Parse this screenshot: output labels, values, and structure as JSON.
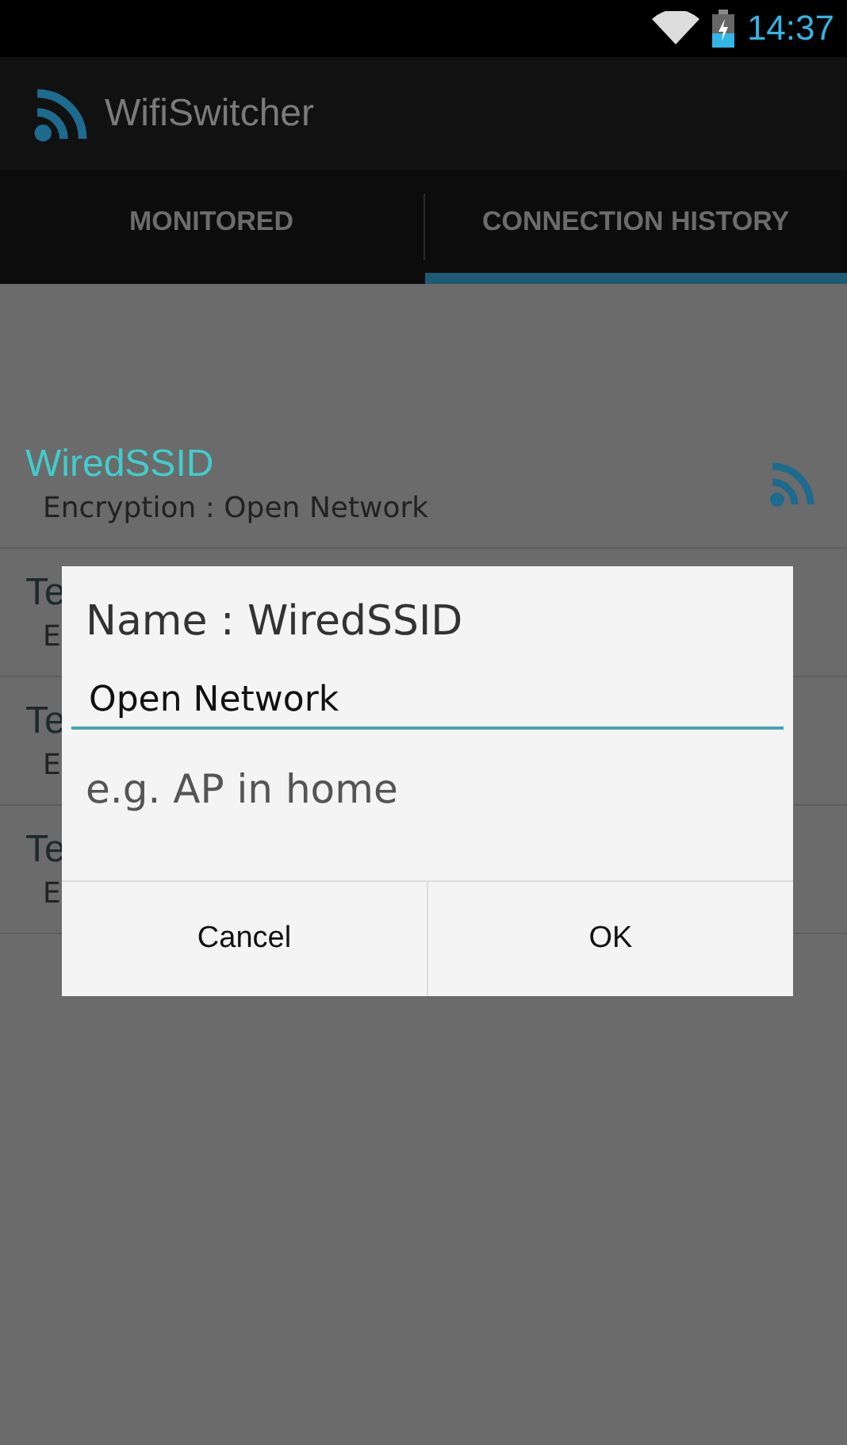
{
  "status_bar": {
    "time": "14:37"
  },
  "action_bar": {
    "title": "WifiSwitcher"
  },
  "tabs": [
    {
      "label": "MONITORED",
      "selected": false
    },
    {
      "label": "CONNECTION HISTORY",
      "selected": true
    }
  ],
  "networks": [
    {
      "name": "WiredSSID",
      "detail": "Encryption : Open Network",
      "connected": true
    },
    {
      "name": "Te",
      "detail": "E",
      "connected": false
    },
    {
      "name": "Te",
      "detail": "E",
      "connected": false
    },
    {
      "name": "Te",
      "detail": "E",
      "connected": false
    }
  ],
  "dialog": {
    "title": "Name : WiredSSID",
    "value": "Open Network",
    "placeholder": "e.g. AP in home",
    "buttons": [
      "Cancel",
      "OK"
    ]
  }
}
